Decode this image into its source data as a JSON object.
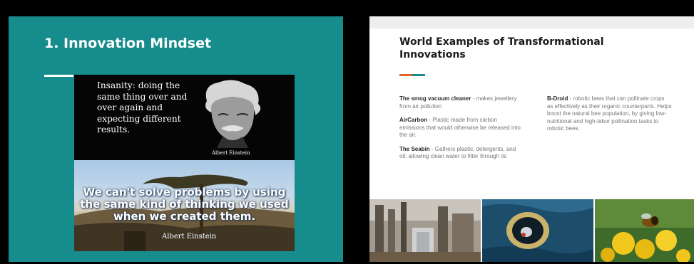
{
  "left_slide": {
    "title": "1. Innovation Mindset",
    "quote_top": {
      "text": "Insanity: doing the same thing over and over again and expecting different results.",
      "author": "Albert Einstein"
    },
    "quote_bottom": {
      "text": "We can't solve problems by using the same kind of thinking we used when we created them.",
      "author": "Albert Einstein"
    }
  },
  "right_slide": {
    "title": "World Examples of Transformational Innovations",
    "accent_colors": [
      "#e0622a",
      "#1b8c8c"
    ],
    "left_column": [
      {
        "name": "The smog vacuum cleaner",
        "description": " - makes jewellery from air pollution"
      },
      {
        "name": "AirCarbon",
        "description": " - Plastic made from carbon emissions that would otherwise be released into the air."
      },
      {
        "name": "The Seabin",
        "description": " - Gathers plastic, detergents, and oil; allowing clean water to filter through its"
      }
    ],
    "right_column": [
      {
        "name": "B-Droid",
        "description": " - robotic bees that can pollinate crops as effectively as their organic counterparts. Helps boost the natural bee population, by giving low-nutritional and high-labor pollination tasks to robotic bees."
      }
    ],
    "photos": [
      "smog-vacuum-tower-photo",
      "seabin-photo",
      "bee-pollinating-flower-photo"
    ]
  },
  "colors": {
    "left_background": "#168c8c",
    "right_background": "#ffffff",
    "page_background": "#000000"
  }
}
